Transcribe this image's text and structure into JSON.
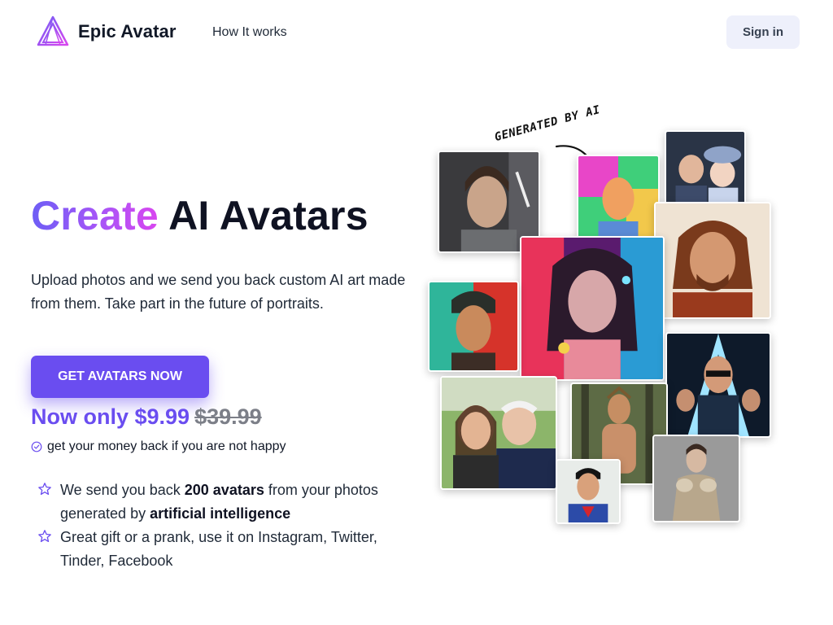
{
  "header": {
    "brand": "Epic Avatar",
    "nav_link": "How It works",
    "signin_label": "Sign in"
  },
  "hero": {
    "headline_accent": "Create",
    "headline_rest": " AI Avatars",
    "subcopy": "Upload photos and we send you back custom AI art made from them. Take part in the future of portraits.",
    "cta_label": "GET AVATARS NOW",
    "price_now": "Now only $9.99",
    "price_old": "$39.99",
    "guarantee": "get your money back if you are not happy",
    "features": [
      {
        "pre": "We send you back ",
        "bold1": "200 avatars",
        "mid": " from your photos generated by ",
        "bold2": "artificial intelligence"
      },
      {
        "text": "Great gift or a prank, use it on Instagram, Twitter, Tinder, Facebook"
      }
    ]
  },
  "collage": {
    "label": "GENERATED BY AI"
  },
  "colors": {
    "accent": "#6a4df0",
    "gradient_start": "#6d5ef5",
    "gradient_end": "#d946ef",
    "signin_bg": "#eef0fb"
  },
  "icons": [
    "logo-icon",
    "check-circle-icon",
    "star-icon",
    "curved-arrow-icon"
  ]
}
